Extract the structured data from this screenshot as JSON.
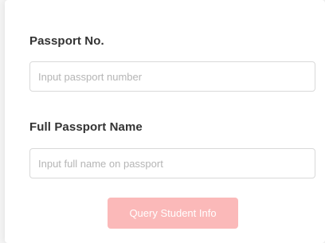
{
  "form": {
    "passport_no": {
      "label": "Passport No.",
      "placeholder": "Input passport number",
      "value": ""
    },
    "full_name": {
      "label": "Full Passport Name",
      "placeholder": "Input full name on passport",
      "value": ""
    },
    "submit_label": "Query Student Info"
  },
  "colors": {
    "button_bg": "#fbb9b9",
    "button_text": "#ffffff",
    "label_text": "#333333",
    "placeholder_text": "#b5b5b5"
  }
}
